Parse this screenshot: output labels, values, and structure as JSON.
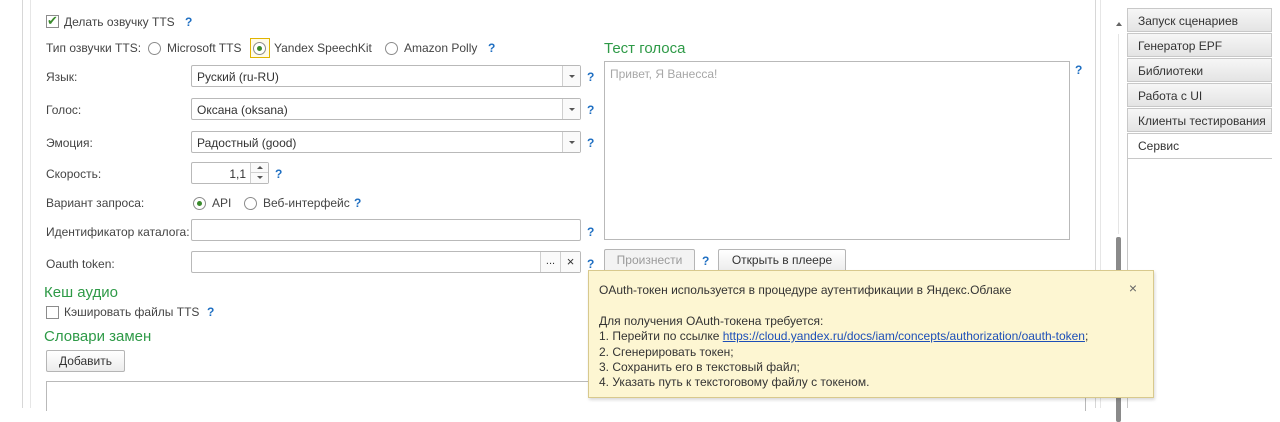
{
  "tts": {
    "enable_label": "Делать озвучку TTS",
    "enable_checked": true,
    "type_label": "Тип озвучки TTS:",
    "type_options": [
      "Microsoft TTS",
      "Yandex SpeechKit",
      "Amazon Polly"
    ],
    "type_selected": "Yandex SpeechKit",
    "help": "?"
  },
  "form": {
    "language": {
      "label": "Язык:",
      "value": "Руский (ru-RU)"
    },
    "voice": {
      "label": "Голос:",
      "value": "Оксана (oksana)"
    },
    "emotion": {
      "label": "Эмоция:",
      "value": "Радостный (good)"
    },
    "speed": {
      "label": "Скорость:",
      "value": "1,1"
    },
    "request_variant": {
      "label": "Вариант запроса:",
      "options": [
        "API",
        "Веб-интерфейс"
      ],
      "selected": "API"
    },
    "catalog_id": {
      "label": "Идентификатор каталога:",
      "value": ""
    },
    "oauth_token": {
      "label": "Oauth token:",
      "value": "",
      "select_btn": "...",
      "clear_btn": "×"
    }
  },
  "voice_test": {
    "title": "Тест голоса",
    "placeholder": "Привет, Я Ванесса!",
    "speak_button": "Произнести",
    "open_player_button": "Открыть в плеере"
  },
  "audio_cache": {
    "title": "Кеш аудио",
    "checkbox_label": "Кэшировать файлы TTS",
    "checked": false
  },
  "dictionaries": {
    "title": "Словари замен",
    "add_button": "Добавить"
  },
  "tabs": [
    {
      "label": "Запуск сценариев",
      "active": false
    },
    {
      "label": "Генератор EPF",
      "active": false
    },
    {
      "label": "Библиотеки",
      "active": false
    },
    {
      "label": "Работа с UI",
      "active": false
    },
    {
      "label": "Клиенты тестирования",
      "active": false
    },
    {
      "label": "Сервис",
      "active": true
    }
  ],
  "tooltip": {
    "line1": "OAuth-токен используется в процедуре аутентификации в Яндекс.Облаке",
    "line2": "Для получения OAuth-токена требуется:",
    "line3_prefix": "1. Перейти по ссылке ",
    "line3_link": "https://cloud.yandex.ru/docs/iam/concepts/authorization/oauth-token",
    "line3_suffix": ";",
    "line4": "2. Сгенерировать токен;",
    "line5": "3. Сохранить его в текстовый файл;",
    "line6": "4. Указать путь к текстоговому файлу с токеном.",
    "close": "×"
  },
  "colors": {
    "accent_green": "#2e9a47",
    "help_blue": "#1f6fc2",
    "tooltip_bg": "#fdf6d2"
  }
}
